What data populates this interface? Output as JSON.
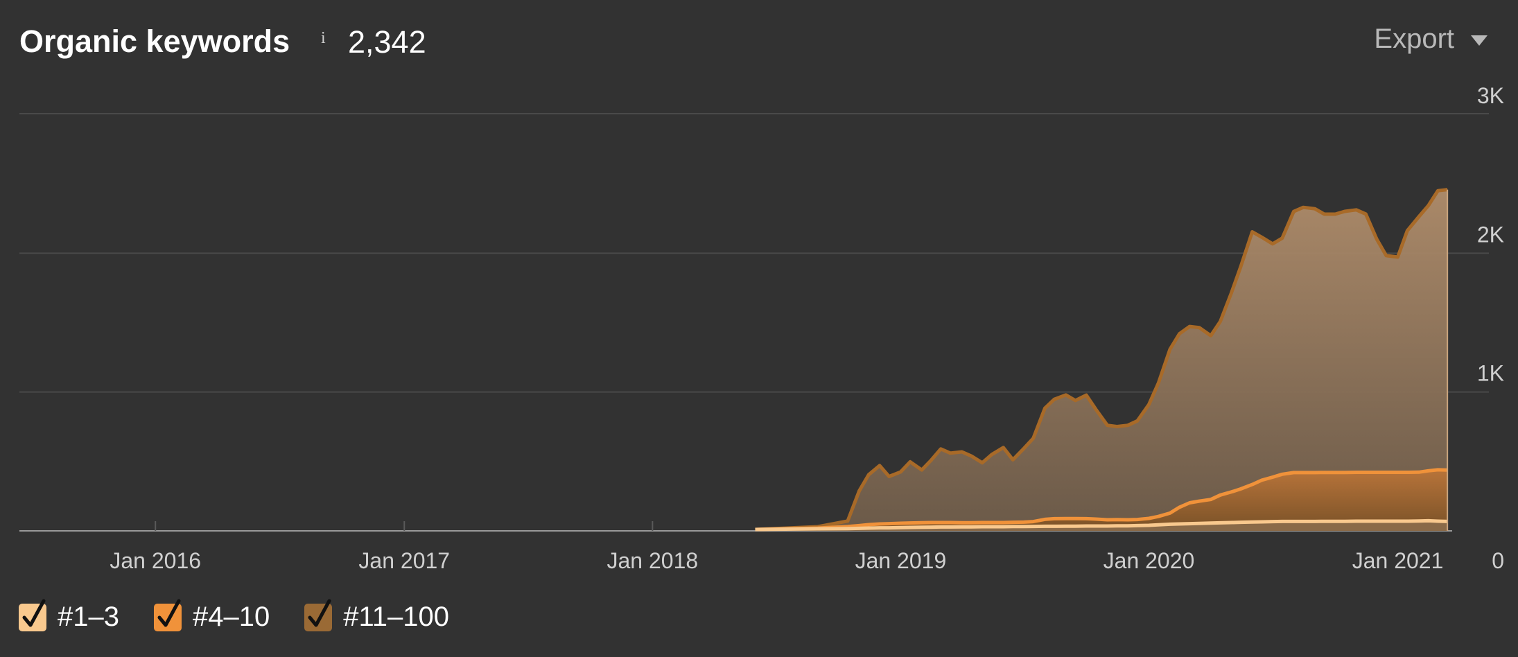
{
  "header": {
    "title": "Organic keywords",
    "info_glyph": "i",
    "total": "2,342",
    "export_label": "Export",
    "export_icon": "caret-down-icon"
  },
  "colors": {
    "background": "#323232",
    "grid": "#4a4a4a",
    "top3": "#f9c98e",
    "top4_10": "#f0923a",
    "top11_100": "#9a6a35",
    "top11_100_line": "#a86a28"
  },
  "legend": [
    {
      "label": "#1–3",
      "checked": true,
      "color": "#f9c98e"
    },
    {
      "label": "#4–10",
      "checked": true,
      "color": "#f0923a"
    },
    {
      "label": "#11–100",
      "checked": true,
      "color": "#9a6a35"
    }
  ],
  "chart_data": {
    "type": "area",
    "stacked": true,
    "x_tick_labels": [
      "Jan 2016",
      "Jan 2017",
      "Jan 2018",
      "Jan 2019",
      "Jan 2020",
      "Jan 2021"
    ],
    "y_tick_labels": [
      "0",
      "1K",
      "2K",
      "3K"
    ],
    "ylim": [
      0,
      3000
    ],
    "xlim": [
      "2015-06-15",
      "2021-05-15"
    ],
    "y_axis_side": "right",
    "grid": true,
    "legend_position": "bottom-left",
    "x": [
      "2018-06-01",
      "2018-09-01",
      "2018-10-15",
      "2018-11-01",
      "2018-11-15",
      "2018-12-01",
      "2018-12-15",
      "2019-01-01",
      "2019-01-15",
      "2019-02-01",
      "2019-02-15",
      "2019-03-01",
      "2019-03-15",
      "2019-04-01",
      "2019-04-15",
      "2019-05-01",
      "2019-05-15",
      "2019-06-01",
      "2019-06-15",
      "2019-07-01",
      "2019-07-15",
      "2019-08-01",
      "2019-08-15",
      "2019-09-01",
      "2019-09-15",
      "2019-10-01",
      "2019-10-15",
      "2019-11-01",
      "2019-11-15",
      "2019-12-01",
      "2019-12-15",
      "2020-01-01",
      "2020-01-15",
      "2020-02-01",
      "2020-02-15",
      "2020-03-01",
      "2020-03-15",
      "2020-04-01",
      "2020-04-15",
      "2020-05-01",
      "2020-05-15",
      "2020-06-01",
      "2020-06-15",
      "2020-07-01",
      "2020-07-15",
      "2020-08-01",
      "2020-08-15",
      "2020-09-01",
      "2020-09-15",
      "2020-10-01",
      "2020-10-15",
      "2020-11-01",
      "2020-11-15",
      "2020-12-01",
      "2020-12-15",
      "2021-01-01",
      "2021-01-15",
      "2021-02-01",
      "2021-02-15",
      "2021-03-01",
      "2021-03-15"
    ],
    "series": [
      {
        "name": "#1–3",
        "values": [
          10,
          15,
          16,
          18,
          20,
          22,
          22,
          24,
          25,
          26,
          27,
          28,
          28,
          29,
          29,
          30,
          30,
          30,
          31,
          31,
          32,
          33,
          33,
          34,
          34,
          35,
          35,
          35,
          36,
          36,
          38,
          40,
          44,
          48,
          50,
          52,
          54,
          56,
          58,
          60,
          62,
          64,
          65,
          67,
          68,
          68,
          68,
          68,
          69,
          69,
          69,
          70,
          70,
          70,
          70,
          70,
          70,
          71,
          73,
          70,
          68
        ]
      },
      {
        "name": "#4–10",
        "values": [
          0,
          5,
          15,
          20,
          25,
          28,
          30,
          31,
          32,
          33,
          33,
          32,
          32,
          30,
          30,
          30,
          30,
          30,
          31,
          32,
          35,
          50,
          55,
          55,
          55,
          53,
          50,
          45,
          45,
          44,
          44,
          50,
          60,
          80,
          120,
          150,
          160,
          170,
          200,
          220,
          240,
          270,
          300,
          320,
          340,
          352,
          352,
          352,
          352,
          352,
          352,
          352,
          352,
          352,
          352,
          352,
          352,
          352,
          360,
          370,
          370
        ]
      },
      {
        "name": "#11–100",
        "values": [
          0,
          10,
          40,
          250,
          360,
          420,
          340,
          370,
          440,
          380,
          450,
          530,
          500,
          510,
          480,
          430,
          490,
          540,
          450,
          530,
          600,
          800,
          860,
          890,
          850,
          890,
          790,
          680,
          670,
          680,
          710,
          820,
          960,
          1180,
          1250,
          1270,
          1250,
          1180,
          1250,
          1430,
          1600,
          1820,
          1750,
          1680,
          1700,
          1880,
          1910,
          1900,
          1860,
          1860,
          1880,
          1890,
          1860,
          1680,
          1560,
          1550,
          1740,
          1840,
          1910,
          2010,
          2020
        ]
      }
    ]
  }
}
